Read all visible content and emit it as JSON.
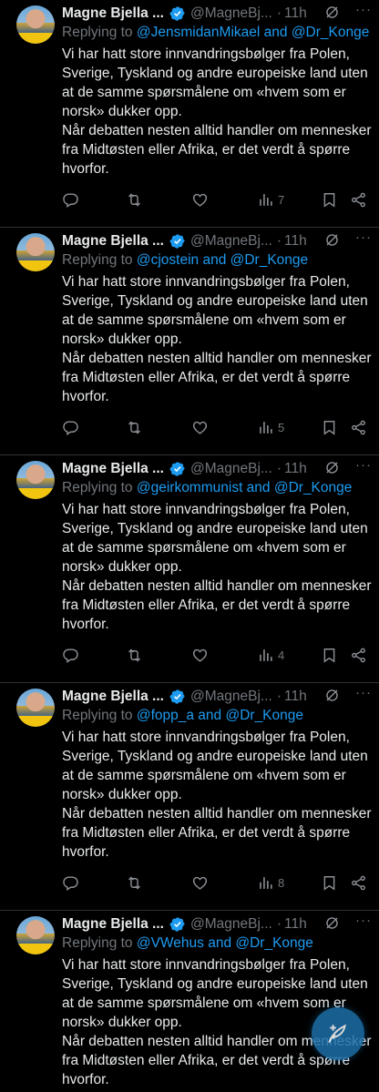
{
  "colors": {
    "background": "#000000",
    "text": "#e7e9ea",
    "muted": "#71767b",
    "accent": "#1d9bf0",
    "divider": "#2f3336"
  },
  "tweets": [
    {
      "name": "Magne Bjella ...",
      "handle": "@MagneBj...",
      "time": "11h",
      "replying_prefix": "Replying to ",
      "replying_to": "@JensmidanMikael and @Dr_Konge",
      "body": "Vi har hatt store innvandringsbølger fra Polen, Sverige, Tyskland og andre europeiske land uten at de samme spørsmålene om «hvem som er norsk» dukker opp.\nNår debatten nesten alltid handler om mennesker fra Midtøsten eller Afrika, er det verdt å spørre hvorfor.",
      "views": "7"
    },
    {
      "name": "Magne Bjella ...",
      "handle": "@MagneBj...",
      "time": "11h",
      "replying_prefix": "Replying to ",
      "replying_to": "@cjostein and @Dr_Konge",
      "body": "Vi har hatt store innvandringsbølger fra Polen, Sverige, Tyskland og andre europeiske land uten at de samme spørsmålene om «hvem som er norsk» dukker opp.\nNår debatten nesten alltid handler om mennesker fra Midtøsten eller Afrika, er det verdt å spørre hvorfor.",
      "views": "5"
    },
    {
      "name": "Magne Bjella ...",
      "handle": "@MagneBj...",
      "time": "11h",
      "replying_prefix": "Replying to ",
      "replying_to": "@geirkommunist and @Dr_Konge",
      "body": "Vi har hatt store innvandringsbølger fra Polen, Sverige, Tyskland og andre europeiske land uten at de samme spørsmålene om «hvem som er norsk» dukker opp.\nNår debatten nesten alltid handler om mennesker fra Midtøsten eller Afrika, er det verdt å spørre hvorfor.",
      "views": "4"
    },
    {
      "name": "Magne Bjella ...",
      "handle": "@MagneBj...",
      "time": "11h",
      "replying_prefix": "Replying to ",
      "replying_to": "@fopp_a and @Dr_Konge",
      "body": "Vi har hatt store innvandringsbølger fra Polen, Sverige, Tyskland og andre europeiske land uten at de samme spørsmålene om «hvem som er norsk» dukker opp.\nNår debatten nesten alltid handler om mennesker fra Midtøsten eller Afrika, er det verdt å spørre hvorfor.",
      "views": "8"
    },
    {
      "name": "Magne Bjella ...",
      "handle": "@MagneBj...",
      "time": "11h",
      "replying_prefix": "Replying to ",
      "replying_to": "@VWehus and @Dr_Konge",
      "body": "Vi har hatt store innvandringsbølger fra Polen, Sverige, Tyskland og andre europeiske land uten at de samme spørsmålene om «hvem som er norsk» dukker opp.\nNår debatten nesten alltid handler om mennesker fra Midtøsten eller Afrika, er det verdt å spørre hvorfor.",
      "views": ""
    }
  ],
  "icons": {
    "verified": "verified-badge-icon",
    "grok": "grok-icon",
    "reply": "reply-icon",
    "repost": "repost-icon",
    "like": "like-icon",
    "views": "views-icon",
    "bookmark": "bookmark-icon",
    "share": "share-icon",
    "compose": "compose-post-icon"
  }
}
